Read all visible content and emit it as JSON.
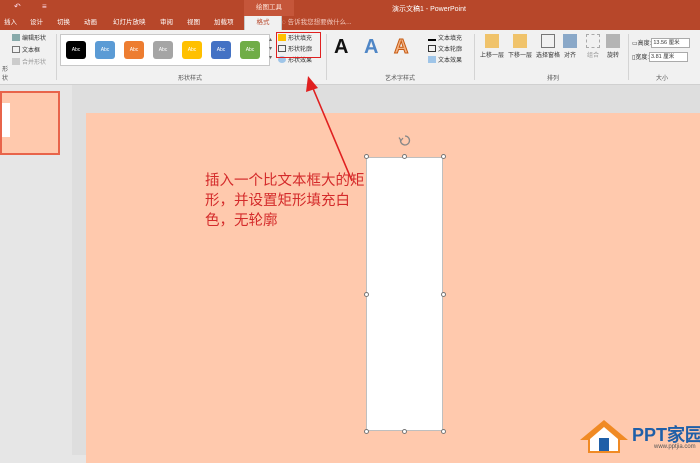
{
  "window": {
    "doc_title": "演示文稿1 - PowerPoint",
    "context_tools": "绘图工具",
    "quick_access": [
      "↶",
      "≡"
    ]
  },
  "tabs": [
    {
      "label": "插入"
    },
    {
      "label": "设计"
    },
    {
      "label": "切换"
    },
    {
      "label": "动画"
    },
    {
      "label": "幻灯片放映"
    },
    {
      "label": "审阅"
    },
    {
      "label": "视图"
    },
    {
      "label": "加载项"
    },
    {
      "label": "格式"
    }
  ],
  "tell_me": "告诉我您想要做什么...",
  "ribbon": {
    "insert_shapes": {
      "items": [
        "编辑形状",
        "文本框",
        "合并形状"
      ],
      "label": "形状"
    },
    "shape_styles": {
      "label": "形状样式",
      "swatches": [
        {
          "text": "Abc",
          "color": "#000000"
        },
        {
          "text": "Abc",
          "color": "#5b9bd5"
        },
        {
          "text": "Abc",
          "color": "#ed7d31"
        },
        {
          "text": "Abc",
          "color": "#a5a5a5"
        },
        {
          "text": "Abc",
          "color": "#ffc000"
        },
        {
          "text": "Abc",
          "color": "#4472c4"
        },
        {
          "text": "Abc",
          "color": "#70ad47"
        }
      ],
      "fill": "形状填充",
      "outline": "形状轮廓",
      "effects": "形状效果"
    },
    "wordart": {
      "label": "艺术字样式",
      "samples": [
        "A",
        "A",
        "A"
      ],
      "text_fill": "文本填充",
      "text_outline": "文本轮廓",
      "text_effects": "文本效果"
    },
    "arrange": {
      "label": "排列",
      "buttons": [
        "上移一层",
        "下移一层",
        "选择窗格",
        "对齐",
        "组合",
        "旋转"
      ]
    },
    "size": {
      "label": "大小",
      "height_label": "高度:",
      "height_value": "13.56 厘米",
      "width_label": "宽度:",
      "width_value": "3.81 厘米"
    }
  },
  "annotation": "插入一个比文本框大的矩形，并设置矩形填充白色，无轮廓",
  "colors": {
    "accent": "#b7472a",
    "slide_bg": "#ffc9ad",
    "annotation": "#d42b2b"
  },
  "logo": {
    "name": "PPT家园",
    "url": "www.pptjia.com"
  }
}
